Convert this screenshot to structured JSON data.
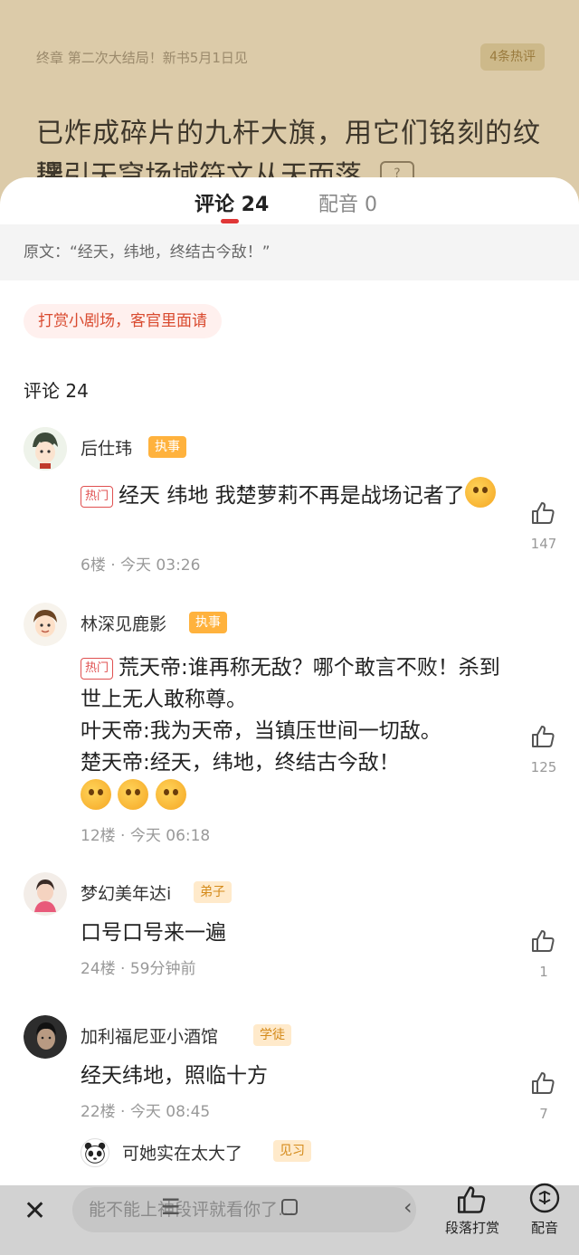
{
  "reader": {
    "chapter": "终章 第二次大结局！新书5月1日见",
    "hot_badge": "4条热评",
    "line1": "已炸成碎片的九杆大旗，用它们铭刻的纹理",
    "line2": "接引天穹场域符文从天而落",
    "help_icon": "?"
  },
  "tabs": {
    "comments": "评论 24",
    "dubbing": "配音 0"
  },
  "quote": "原文：“经天，纬地，终结古今敌！”",
  "reward_pill": "打赏小剧场，客官里面请",
  "comments_heading": "评论 24",
  "comments": [
    {
      "user": "后仕玮",
      "role": "执事",
      "hot": "热门",
      "text": "经天 纬地 我楚萝莉不再是战场记者了",
      "meta": "6楼 · 今天 03:26",
      "likes": "147"
    },
    {
      "user": "林深见鹿影",
      "role": "执事",
      "hot": "热门",
      "line1": "荒天帝:谁再称无敌？哪个敢言不败！杀到世上无人敢称尊。",
      "line2": "叶天帝:我为天帝，当镇压世间一切敌。",
      "line3": "楚天帝:经天，纬地，终结古今敌！",
      "meta": "12楼 · 今天 06:18",
      "likes": "125"
    },
    {
      "user": "梦幻美年达i",
      "role": "弟子",
      "text": "口号口号来一遍",
      "meta": "24楼 · 59分钟前",
      "likes": "1"
    },
    {
      "user": "加利福尼亚小酒馆",
      "role": "学徒",
      "text": "经天纬地，照临十方",
      "meta": "22楼 · 今天 08:45",
      "likes": "7",
      "reply_text": "可她实在太大了",
      "reply_role": "见习"
    }
  ],
  "bottom": {
    "input_placeholder": "能不能上神段评就看你了...",
    "reward_label": "段落打赏",
    "dubbing_label": "配音"
  }
}
